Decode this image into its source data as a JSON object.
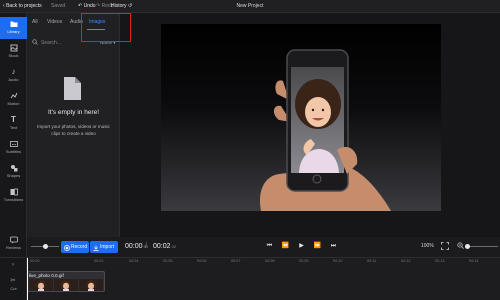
{
  "topbar": {
    "back": "Back to projects",
    "saved": "Saved",
    "undo": "Undo",
    "redo": "Redo",
    "history": "History",
    "title": "New Project"
  },
  "rail": [
    {
      "id": "library",
      "label": "Library",
      "icon": "folder-icon",
      "active": true
    },
    {
      "id": "stock",
      "label": "Stock",
      "icon": "stock-icon"
    },
    {
      "id": "audio",
      "label": "Audio",
      "icon": "music-icon"
    },
    {
      "id": "motion",
      "label": "Motion",
      "icon": "motion-icon"
    },
    {
      "id": "text",
      "label": "Text",
      "icon": "text-icon"
    },
    {
      "id": "subtitles",
      "label": "Subtitles",
      "icon": "subtitles-icon"
    },
    {
      "id": "shapes",
      "label": "Shapes",
      "icon": "shapes-icon"
    },
    {
      "id": "transitions",
      "label": "Transitions",
      "icon": "transitions-icon"
    },
    {
      "id": "reviews",
      "label": "Reviews",
      "icon": "reviews-icon"
    }
  ],
  "library": {
    "tabs": [
      "All",
      "Videos",
      "Audio",
      "Images"
    ],
    "active_tab": "Images",
    "search_placeholder": "Search...",
    "sort_label": "Name",
    "empty_title": "It's empty in here!",
    "empty_subtitle": "Import your photos, videos or music clips to create a video"
  },
  "controls": {
    "record_label": "Record",
    "import_label": "Import",
    "time_current": "00:00",
    "time_current_frames": "00",
    "time_total": "00:02",
    "time_total_frames": "02",
    "zoom_level": "100%"
  },
  "timeline": {
    "ticks": [
      "00:00",
      "00:02",
      "00:04",
      "00:05",
      "00:06",
      "00:07",
      "00:08",
      "00:09",
      "00:10",
      "00:11",
      "00:12",
      "00:13",
      "00:14"
    ],
    "clip_label": "live_photo 0.0.gif",
    "side_labels": {
      "expand": "",
      "cut": "Cut"
    }
  },
  "colors": {
    "accent": "#1e6cf0",
    "annotation": "#e01e1e"
  }
}
